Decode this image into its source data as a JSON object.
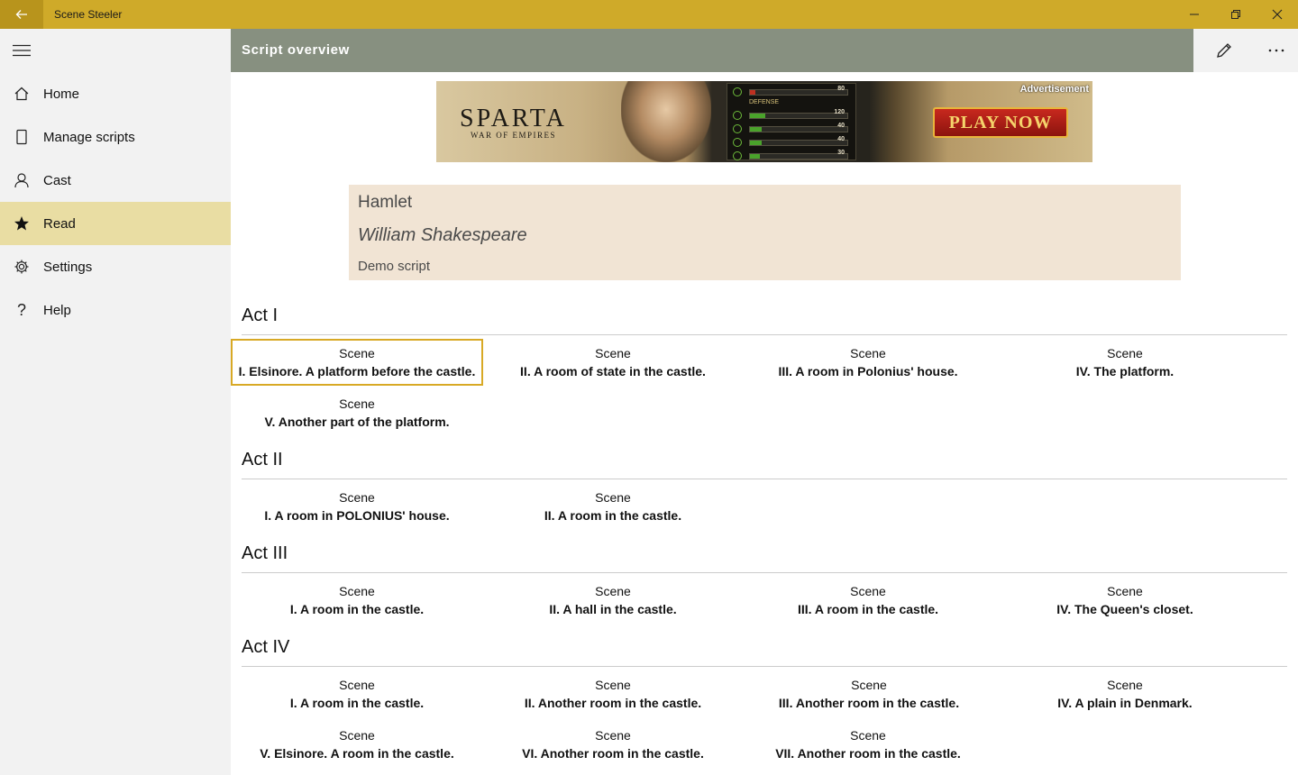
{
  "window": {
    "app_title": "Scene Steeler",
    "back_icon": "back-arrow-icon",
    "controls": [
      "minimize-icon",
      "restore-icon",
      "close-icon"
    ],
    "title_color": "#cfaa29"
  },
  "sidebar": {
    "items": [
      {
        "label": "Home",
        "icon": "home-icon",
        "selected": false
      },
      {
        "label": "Manage scripts",
        "icon": "document-icon",
        "selected": false
      },
      {
        "label": "Cast",
        "icon": "person-icon",
        "selected": false
      },
      {
        "label": "Read",
        "icon": "star-icon",
        "selected": true
      },
      {
        "label": "Settings",
        "icon": "gear-icon",
        "selected": false
      },
      {
        "label": "Help",
        "icon": "question-icon",
        "selected": false
      }
    ]
  },
  "header": {
    "title": "Script overview",
    "edit_icon": "pencil-icon",
    "more_icon": "more-icon"
  },
  "ad": {
    "label": "Advertisement",
    "brand": "SPARTA",
    "tagline": "WAR OF EMPIRES",
    "defense_label": "DEFENSE",
    "stats": [
      "80",
      "120",
      "40",
      "40",
      "30"
    ],
    "cta": "PLAY NOW"
  },
  "script": {
    "title": "Hamlet",
    "author": "William Shakespeare",
    "note": "Demo script"
  },
  "acts": [
    {
      "name": "Act I",
      "scenes": [
        {
          "word": "Scene",
          "name": "I. Elsinore. A platform before the castle."
        },
        {
          "word": "Scene",
          "name": "II. A room of state in the castle."
        },
        {
          "word": "Scene",
          "name": "III. A room in Polonius' house."
        },
        {
          "word": "Scene",
          "name": "IV. The platform."
        },
        {
          "word": "Scene",
          "name": "V. Another part of the platform."
        }
      ]
    },
    {
      "name": "Act II",
      "scenes": [
        {
          "word": "Scene",
          "name": "I. A room in POLONIUS' house."
        },
        {
          "word": "Scene",
          "name": "II. A room in the castle."
        }
      ]
    },
    {
      "name": "Act III",
      "scenes": [
        {
          "word": "Scene",
          "name": "I. A room in the castle."
        },
        {
          "word": "Scene",
          "name": "II. A hall in the castle."
        },
        {
          "word": "Scene",
          "name": "III. A room in the castle."
        },
        {
          "word": "Scene",
          "name": "IV. The Queen's closet."
        }
      ]
    },
    {
      "name": "Act IV",
      "scenes": [
        {
          "word": "Scene",
          "name": "I. A room in the castle."
        },
        {
          "word": "Scene",
          "name": "II. Another room in the castle."
        },
        {
          "word": "Scene",
          "name": "III. Another room in the castle."
        },
        {
          "word": "Scene",
          "name": "IV. A plain in Denmark."
        },
        {
          "word": "Scene",
          "name": "V. Elsinore. A room in the castle."
        },
        {
          "word": "Scene",
          "name": "VI. Another room in the castle."
        },
        {
          "word": "Scene",
          "name": "VII. Another room in the castle."
        }
      ]
    }
  ]
}
